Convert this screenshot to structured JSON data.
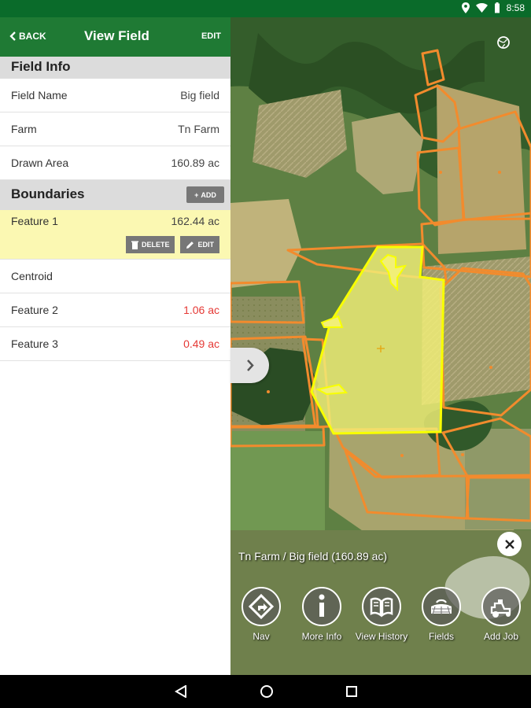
{
  "status": {
    "time": "8:58"
  },
  "appbar": {
    "back": "BACK",
    "title": "View Field",
    "edit": "EDIT"
  },
  "field_info": {
    "heading": "Field Info",
    "rows": [
      {
        "label": "Field Name",
        "value": "Big field"
      },
      {
        "label": "Farm",
        "value": "Tn Farm"
      },
      {
        "label": "Drawn Area",
        "value": "160.89 ac"
      }
    ]
  },
  "boundaries": {
    "heading": "Boundaries",
    "add_label": "ADD",
    "features": [
      {
        "label": "Feature 1",
        "value": "162.44 ac",
        "delete_label": "DELETE",
        "edit_label": "EDIT"
      },
      {
        "label": "Centroid",
        "value": ""
      },
      {
        "label": "Feature 2",
        "value": "1.06 ac"
      },
      {
        "label": "Feature 3",
        "value": "0.49 ac"
      }
    ]
  },
  "map": {
    "caption": "Tn Farm / Big field (160.89 ac)",
    "actions": [
      {
        "label": "Nav",
        "icon": "nav-icon"
      },
      {
        "label": "More Info",
        "icon": "info-icon"
      },
      {
        "label": "View History",
        "icon": "history-icon"
      },
      {
        "label": "Fields",
        "icon": "fields-icon"
      },
      {
        "label": "Add Job",
        "icon": "tractor-icon"
      }
    ]
  },
  "colors": {
    "primary": "#1f7a34",
    "status_bar": "#0a6b2a",
    "selected_field": "#f1ef78",
    "boundary": "#f28b2d",
    "warning_value": "#e53935"
  }
}
